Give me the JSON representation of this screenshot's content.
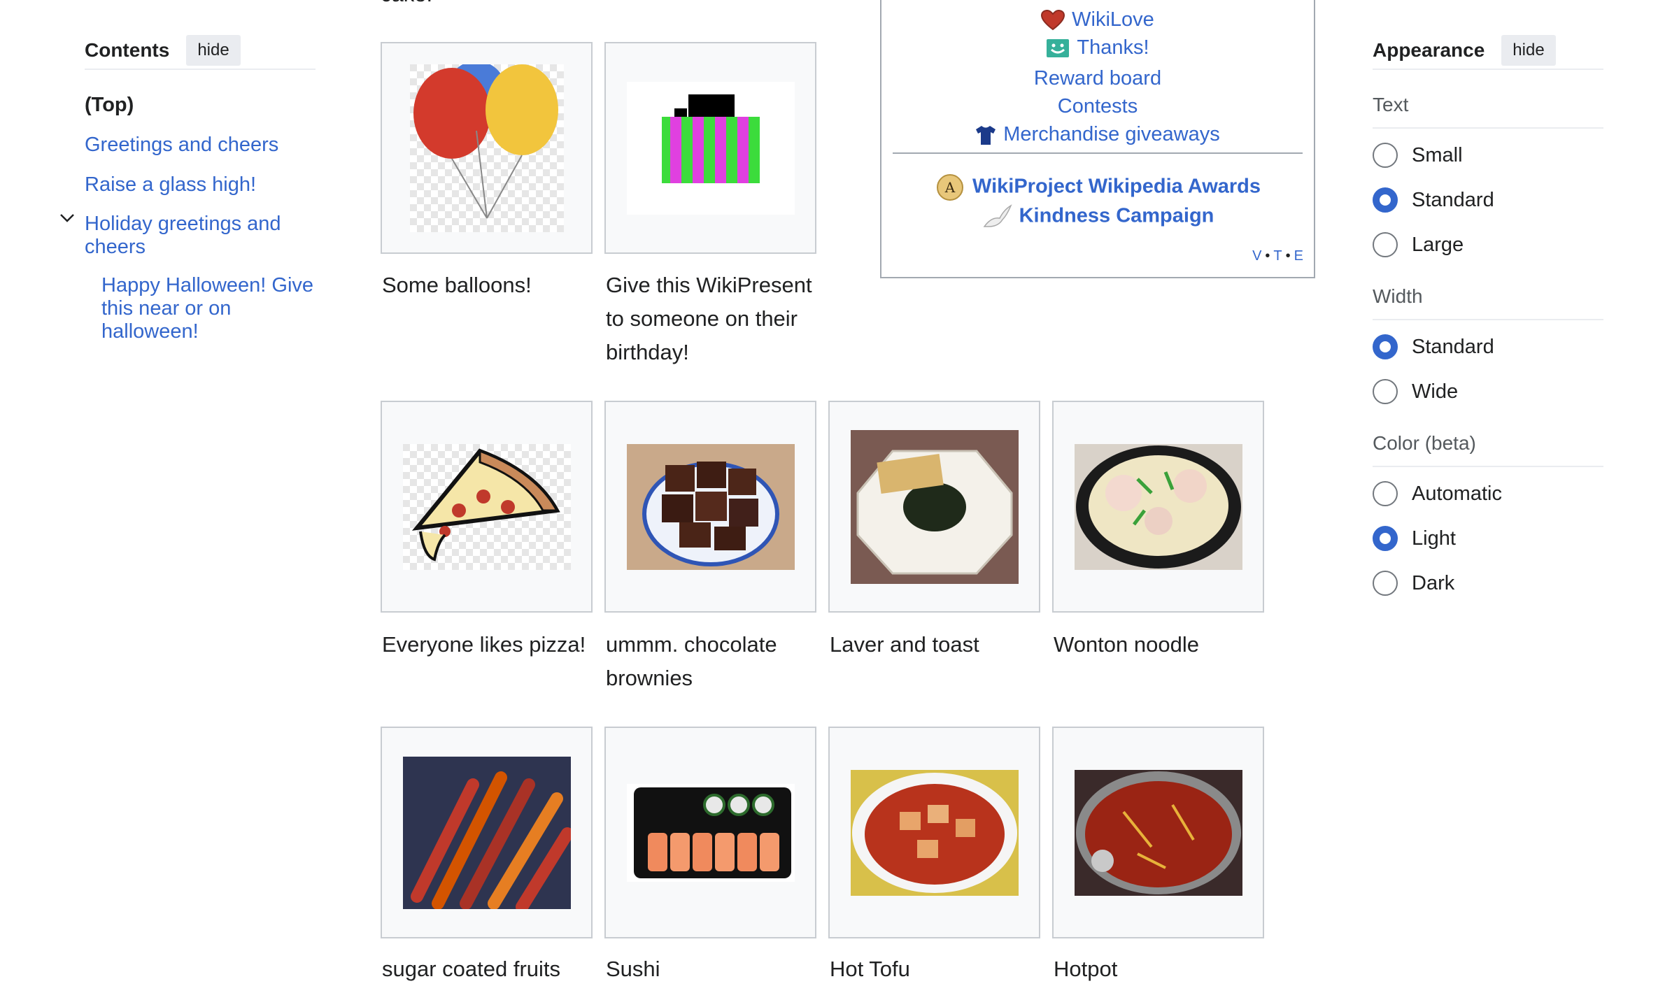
{
  "toc": {
    "title": "Contents",
    "hide_label": "hide",
    "items": [
      {
        "label": "(Top)"
      },
      {
        "label": "Greetings and cheers"
      },
      {
        "label": "Raise a glass high!"
      },
      {
        "label": "Holiday greetings and cheers"
      },
      {
        "label": "Happy Halloween! Give this near or on halloween!"
      }
    ]
  },
  "article": {
    "partial_text": "cake."
  },
  "gallery": [
    {
      "caption": "Some balloons!",
      "image": "balloons"
    },
    {
      "caption": "Give this WikiPresent to someone on their birthday!",
      "image": "present"
    },
    {
      "caption": "Everyone likes pizza!",
      "image": "pizza"
    },
    {
      "caption": "ummm. chocolate brownies",
      "image": "brownies"
    },
    {
      "caption": "Laver and toast",
      "image": "laver-toast"
    },
    {
      "caption": "Wonton noodle",
      "image": "wonton-noodle"
    },
    {
      "caption": "sugar coated fruits",
      "image": "sugar-fruits"
    },
    {
      "caption": "Sushi",
      "image": "sushi"
    },
    {
      "caption": "Hot Tofu",
      "image": "hot-tofu"
    },
    {
      "caption": "Hotpot",
      "image": "hotpot"
    }
  ],
  "navbox": {
    "links": [
      {
        "label": "WikiLove",
        "icon": "heart-icon"
      },
      {
        "label": "Thanks!",
        "icon": "smiley-icon"
      },
      {
        "label": "Reward board"
      },
      {
        "label": "Contests"
      },
      {
        "label": "Merchandise giveaways",
        "icon": "tshirt-icon"
      }
    ],
    "bold_links": [
      {
        "label": "WikiProject Wikipedia Awards",
        "icon": "award-icon"
      },
      {
        "label": "Kindness Campaign",
        "icon": "dove-icon"
      }
    ],
    "vte": {
      "v": "V",
      "t": "T",
      "e": "E"
    }
  },
  "appearance": {
    "title": "Appearance",
    "hide_label": "hide",
    "text": {
      "heading": "Text",
      "options": [
        "Small",
        "Standard",
        "Large"
      ],
      "selected": "Standard"
    },
    "width": {
      "heading": "Width",
      "options": [
        "Standard",
        "Wide"
      ],
      "selected": "Standard"
    },
    "color": {
      "heading": "Color (beta)",
      "options": [
        "Automatic",
        "Light",
        "Dark"
      ],
      "selected": "Light"
    }
  },
  "colors": {
    "link": "#3366cc",
    "radio_checked": "#3366cc",
    "border": "#c8ccd1"
  }
}
